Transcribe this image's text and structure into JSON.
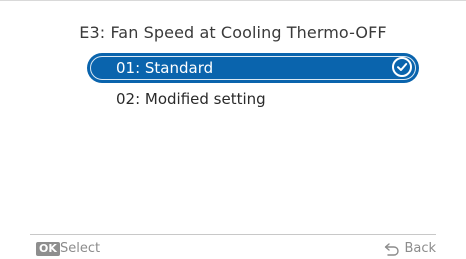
{
  "header": {
    "title": "E3: Fan Speed at Cooling Thermo-OFF"
  },
  "options": [
    {
      "label": "01: Standard",
      "selected": true
    },
    {
      "label": "02: Modified setting",
      "selected": false
    }
  ],
  "footer": {
    "ok_key": "OK",
    "select_label": "Select",
    "back_label": "Back"
  },
  "icons": {
    "selected_marker": "check-circle-icon",
    "back": "back-arrow-icon"
  },
  "colors": {
    "accent": "#0a64ad",
    "text": "#3a3a3a",
    "footer_text": "#8c8c8c"
  }
}
